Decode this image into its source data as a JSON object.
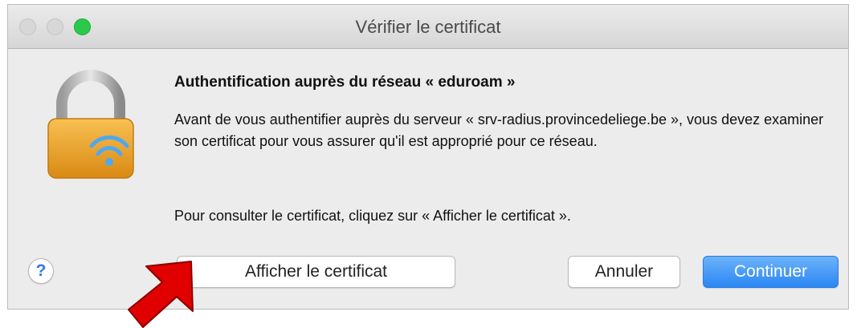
{
  "window": {
    "title": "Vérifier le certificat"
  },
  "content": {
    "heading": "Authentification auprès du réseau « eduroam »",
    "paragraph1": "Avant de vous authentifier auprès du serveur « srv-radius.provincedeliege.be », vous devez examiner son certificat pour vous assurer qu'il est approprié pour ce réseau.",
    "paragraph2": "Pour consulter le certificat, cliquez sur « Afficher le certificat »."
  },
  "buttons": {
    "help": "?",
    "show_certificate": "Afficher le certificat",
    "cancel": "Annuler",
    "continue": "Continuer"
  },
  "icons": {
    "lock": "padlock-wifi-icon",
    "annotation": "red-arrow-icon"
  },
  "colors": {
    "accent": "#2b86f3",
    "close_light": "#d7d7d7",
    "zoom_light": "#2ac94a",
    "annotation_arrow": "#e00000"
  }
}
